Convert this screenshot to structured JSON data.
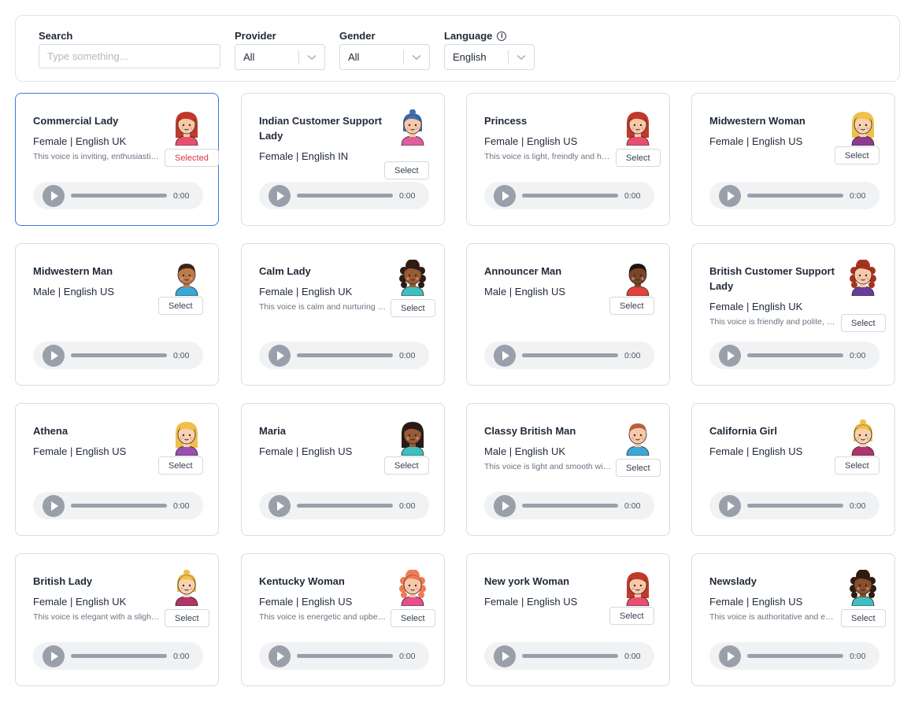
{
  "filters": {
    "search_label": "Search",
    "search_placeholder": "Type something...",
    "provider_label": "Provider",
    "provider_value": "All",
    "gender_label": "Gender",
    "gender_value": "All",
    "language_label": "Language",
    "language_value": "English"
  },
  "colors": {
    "accent": "#3b7ddd",
    "selected_text": "#dc3545",
    "player_bg": "#f1f2f4",
    "player_control": "#9aa0ab"
  },
  "voices": [
    {
      "name": "Commercial Lady",
      "meta": "Female | English UK",
      "desc": "This voice is inviting, enthusiastic and warm",
      "button": "Selected",
      "selected": true,
      "time": "0:00",
      "avatar": {
        "hair": "#c0392b",
        "skin": "#f8c9a8",
        "shirt": "#e84e6f",
        "style": "long"
      }
    },
    {
      "name": "Indian Customer Support Lady",
      "meta": "Female | English IN",
      "desc": "",
      "button": "Select",
      "selected": false,
      "time": "0:00",
      "avatar": {
        "hair": "#3f6fb5",
        "skin": "#f8c9a8",
        "shirt": "#e05da0",
        "style": "bun"
      }
    },
    {
      "name": "Princess",
      "meta": "Female | English US",
      "desc": "This voice is light, freindly and happy",
      "button": "Select",
      "selected": false,
      "time": "0:00",
      "avatar": {
        "hair": "#c0392b",
        "skin": "#f8c9a8",
        "shirt": "#e84e6f",
        "style": "long"
      }
    },
    {
      "name": "Midwestern Woman",
      "meta": "Female | English US",
      "desc": "",
      "button": "Select",
      "selected": false,
      "time": "0:00",
      "avatar": {
        "hair": "#f0c04a",
        "skin": "#f8d2b0",
        "shirt": "#8e3b8e",
        "style": "long"
      }
    },
    {
      "name": "Midwestern Man",
      "meta": "Male | English US",
      "desc": "",
      "button": "Select",
      "selected": false,
      "time": "0:00",
      "avatar": {
        "hair": "#3a2418",
        "skin": "#c07a4a",
        "shirt": "#3aa7d9",
        "style": "short"
      }
    },
    {
      "name": "Calm Lady",
      "meta": "Female | English UK",
      "desc": "This voice is calm and nurturing and soothing",
      "button": "Select",
      "selected": false,
      "time": "0:00",
      "avatar": {
        "hair": "#2e1b12",
        "skin": "#9a5a33",
        "shirt": "#3fbfbf",
        "style": "curly"
      }
    },
    {
      "name": "Announcer Man",
      "meta": "Male | English US",
      "desc": "",
      "button": "Select",
      "selected": false,
      "time": "0:00",
      "avatar": {
        "hair": "#1f1410",
        "skin": "#7a4526",
        "shirt": "#e0413a",
        "style": "short"
      }
    },
    {
      "name": "British Customer Support Lady",
      "meta": "Female | English UK",
      "desc": "This voice is friendly and polite, helpful",
      "button": "Select",
      "selected": false,
      "time": "0:00",
      "avatar": {
        "hair": "#a8321f",
        "skin": "#f8c9a8",
        "shirt": "#6a3d9a",
        "style": "curly"
      }
    },
    {
      "name": "Athena",
      "meta": "Female | English US",
      "desc": "",
      "button": "Select",
      "selected": false,
      "time": "0:00",
      "avatar": {
        "hair": "#f0c04a",
        "skin": "#f8d2b0",
        "shirt": "#9b4fb0",
        "style": "long"
      }
    },
    {
      "name": "Maria",
      "meta": "Female | English US",
      "desc": "",
      "button": "Select",
      "selected": false,
      "time": "0:00",
      "avatar": {
        "hair": "#2a1a14",
        "skin": "#9a5a33",
        "shirt": "#3fbfbf",
        "style": "long"
      }
    },
    {
      "name": "Classy British Man",
      "meta": "Male | English UK",
      "desc": "This voice is light and smooth with refinement",
      "button": "Select",
      "selected": false,
      "time": "0:00",
      "avatar": {
        "hair": "#b5623a",
        "skin": "#f8c9a8",
        "shirt": "#3aa7d9",
        "style": "short"
      }
    },
    {
      "name": "California Girl",
      "meta": "Female | English US",
      "desc": "",
      "button": "Select",
      "selected": false,
      "time": "0:00",
      "avatar": {
        "hair": "#f0c04a",
        "skin": "#f8d2b0",
        "shirt": "#b0356b",
        "style": "bun"
      }
    },
    {
      "name": "British Lady",
      "meta": "Female | English UK",
      "desc": "This voice is elegant with a slight accent",
      "button": "Select",
      "selected": false,
      "time": "0:00",
      "avatar": {
        "hair": "#f0c04a",
        "skin": "#f8d2b0",
        "shirt": "#b0356b",
        "style": "bun"
      }
    },
    {
      "name": "Kentucky Woman",
      "meta": "Female | English US",
      "desc": "This voice is energetic and upbeat and lively",
      "button": "Select",
      "selected": false,
      "time": "0:00",
      "avatar": {
        "hair": "#f07a55",
        "skin": "#f8c9a8",
        "shirt": "#e84e8a",
        "style": "curly"
      }
    },
    {
      "name": "New york Woman",
      "meta": "Female | English US",
      "desc": "",
      "button": "Select",
      "selected": false,
      "time": "0:00",
      "avatar": {
        "hair": "#c0392b",
        "skin": "#f8c9a8",
        "shirt": "#e84e6f",
        "style": "long"
      }
    },
    {
      "name": "Newslady",
      "meta": "Female | English US",
      "desc": "This voice is authoritative and engaging",
      "button": "Select",
      "selected": false,
      "time": "0:00",
      "avatar": {
        "hair": "#2e1b12",
        "skin": "#8a4f2c",
        "shirt": "#3fbfbf",
        "style": "curly"
      }
    }
  ]
}
